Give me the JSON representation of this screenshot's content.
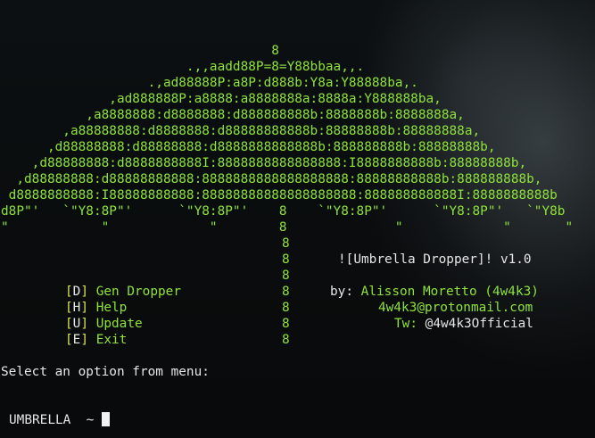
{
  "art": [
    "                                   8",
    "                        .,,aadd88P=8=Y88bbaa,,.",
    "                   .,ad88888P:a8P:d888b:Y8a:Y88888ba,.",
    "              ,ad888888P:a8888:a8888888a:8888a:Y888888ba,",
    "           ,a8888888:d8888888:d888888888b:8888888b:8888888a,",
    "        ,a88888888:d8888888:d88888888888b:88888888b:88888888a,",
    "      ,d88888888:d88888888:d8888888888888b:888888888b:88888888b,",
    "    ,d88888888:d8888888888I:8888888888888888:I8888888888b:88888888b,",
    "  ,d88888888:d88888888888:8888888888888888888:88888888888b:888888888b,",
    " d8888888888:I88888888888:88888888888888888888:888888888888I:8888888888b",
    "d8P\"'   `\"Y8:8P\"'      `\"Y8:8P\"'    8    `\"Y8:8P\"'      `\"Y8:8P\"'   `\"Y8b",
    "\"            \"             \"        8              \"             \"       \""
  ],
  "pole": "8",
  "title": "![Umbrella Dropper]! v1.0",
  "author": {
    "label": "by:",
    "name": "Alisson Moretto (4w4k3)",
    "email": "4w4k3@protonmail.com",
    "tw_label": "Tw:",
    "tw_handle": "@4w4k3Official"
  },
  "menu": [
    {
      "key": "D",
      "label": "Gen Dropper"
    },
    {
      "key": "H",
      "label": "Help"
    },
    {
      "key": "U",
      "label": "Update"
    },
    {
      "key": "E",
      "label": "Exit"
    }
  ],
  "prompt_text": "Select an option from menu:",
  "shell": {
    "name": "UMBRELLA",
    "symbol": "~"
  }
}
